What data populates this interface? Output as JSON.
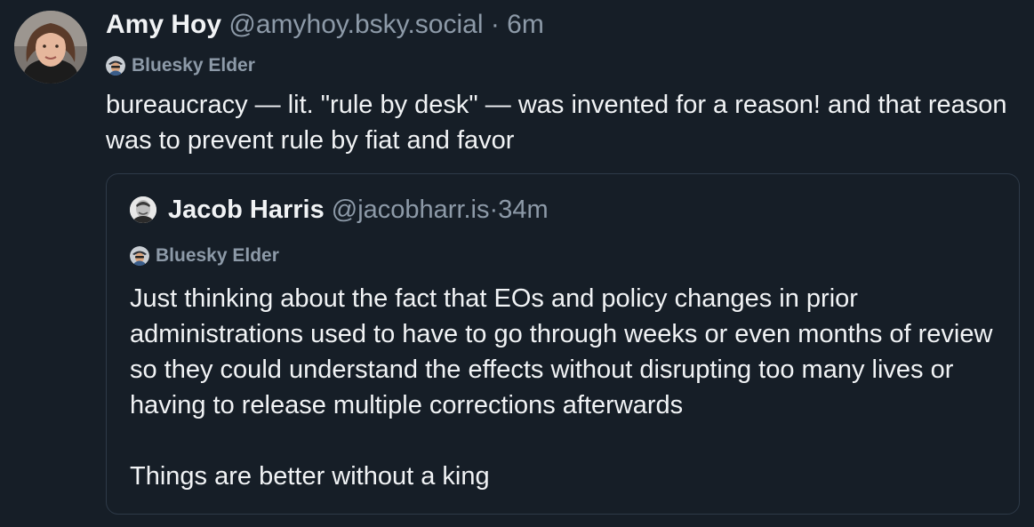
{
  "post": {
    "author": {
      "display_name": "Amy Hoy",
      "handle": "@amyhoy.bsky.social",
      "time": "6m",
      "badge": "Bluesky Elder",
      "avatar_icon": "avatar-photo"
    },
    "separator": " · ",
    "text": "bureaucracy — lit. \"rule by desk\" — was invented for a reason! and that reason was to prevent rule by fiat and favor"
  },
  "quote": {
    "author": {
      "display_name": "Jacob Harris",
      "handle": "@jacobharr.is",
      "time": "34m",
      "badge": "Bluesky Elder",
      "avatar_icon": "avatar-photo"
    },
    "separator": " · ",
    "paragraphs": [
      "Just thinking about the fact that EOs and policy changes in prior administrations used to have to go through weeks or even months of review so they could understand the effects without disrupting too many lives or having to release multiple corrections afterwards",
      "Things are better without a king"
    ]
  },
  "colors": {
    "background": "#161e27",
    "text": "#f1f3f5",
    "muted": "#8d9aa8",
    "border": "#2e3a48"
  }
}
